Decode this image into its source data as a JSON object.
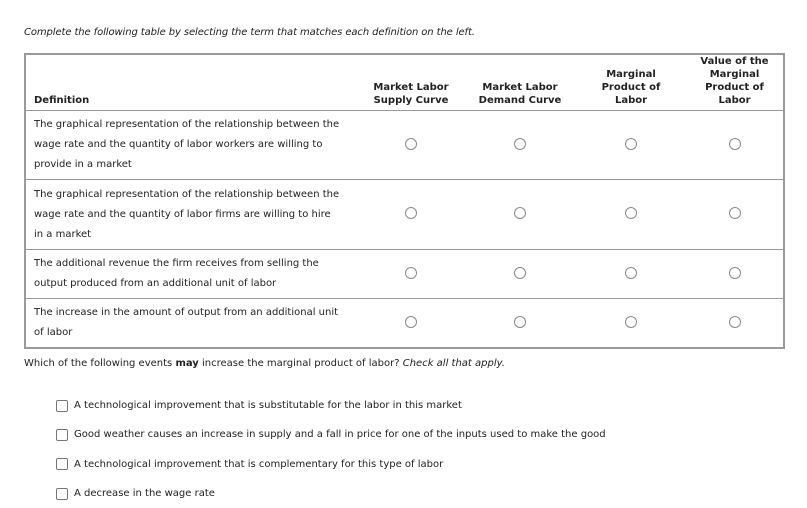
{
  "instructions": "Complete the following table by selecting the term that matches each definition on the left.",
  "table": {
    "headers": [
      "Definition",
      "Market Labor Supply Curve",
      "Market Labor Demand Curve",
      "Marginal Product of Labor",
      "Value of the Marginal Product of Labor"
    ],
    "header_lines": {
      "supply": [
        "Market Labor",
        "Supply Curve"
      ],
      "demand": [
        "Market Labor",
        "Demand Curve"
      ],
      "mpl": [
        "Marginal",
        "Product of",
        "Labor"
      ],
      "vmpl": [
        "Value of the",
        "Marginal Product of",
        "Labor"
      ]
    },
    "rows": [
      {
        "definition_lines": [
          "The graphical representation of the relationship between the",
          "wage rate and the quantity of labor workers are willing to",
          "provide in a market"
        ],
        "selected": null
      },
      {
        "definition_lines": [
          "The graphical representation of the relationship between the",
          "wage rate and the quantity of labor firms are willing to hire",
          "in a market"
        ],
        "selected": null
      },
      {
        "definition_lines": [
          "The additional revenue the firm receives from selling the",
          "output produced from an additional unit of labor"
        ],
        "selected": null
      },
      {
        "definition_lines": [
          "The increase in the amount of output from an additional unit",
          "of labor"
        ],
        "selected": null
      }
    ]
  },
  "question": {
    "prefix": "Which of the following events ",
    "bold": "may",
    "middle": " increase the marginal product of labor? ",
    "italic": "Check all that apply."
  },
  "choices": [
    {
      "label": "A technological improvement that is substitutable for the labor in this market",
      "checked": false
    },
    {
      "label": "Good weather causes an increase in supply and a fall in price for one of the inputs used to make the good",
      "checked": false
    },
    {
      "label": "A technological improvement that is complementary for this type of labor",
      "checked": false
    },
    {
      "label": "A decrease in the wage rate",
      "checked": false
    }
  ]
}
